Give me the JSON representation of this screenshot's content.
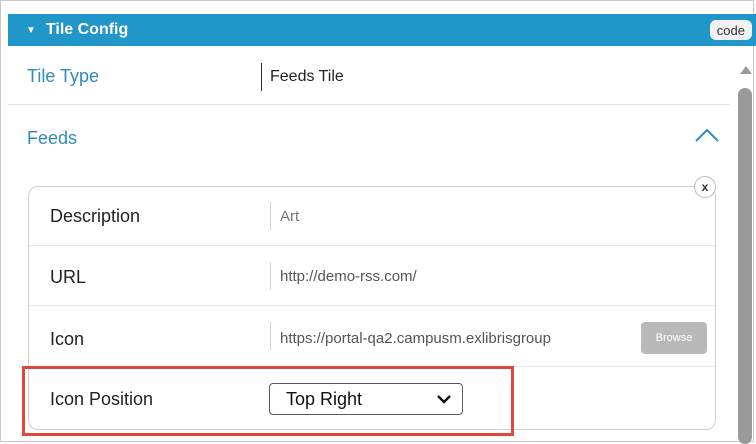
{
  "header": {
    "title": "Tile Config",
    "code_label": "code",
    "accent_color": "#2196c8"
  },
  "tile_type": {
    "label": "Tile Type",
    "value": "Feeds Tile"
  },
  "feeds": {
    "label": "Feeds",
    "collapse_icon": "chevron-up-icon",
    "remove_label": "x",
    "fields": {
      "description": {
        "label": "Description",
        "value": "Art"
      },
      "url": {
        "label": "URL",
        "value": "http://demo-rss.com/"
      },
      "icon": {
        "label": "Icon",
        "value": "https://portal-qa2.campusm.exlibrisgroup",
        "browse_label": "Browse"
      },
      "icon_position": {
        "label": "Icon Position",
        "selected": "Top Right"
      }
    }
  },
  "highlight_color": "#e0473f"
}
